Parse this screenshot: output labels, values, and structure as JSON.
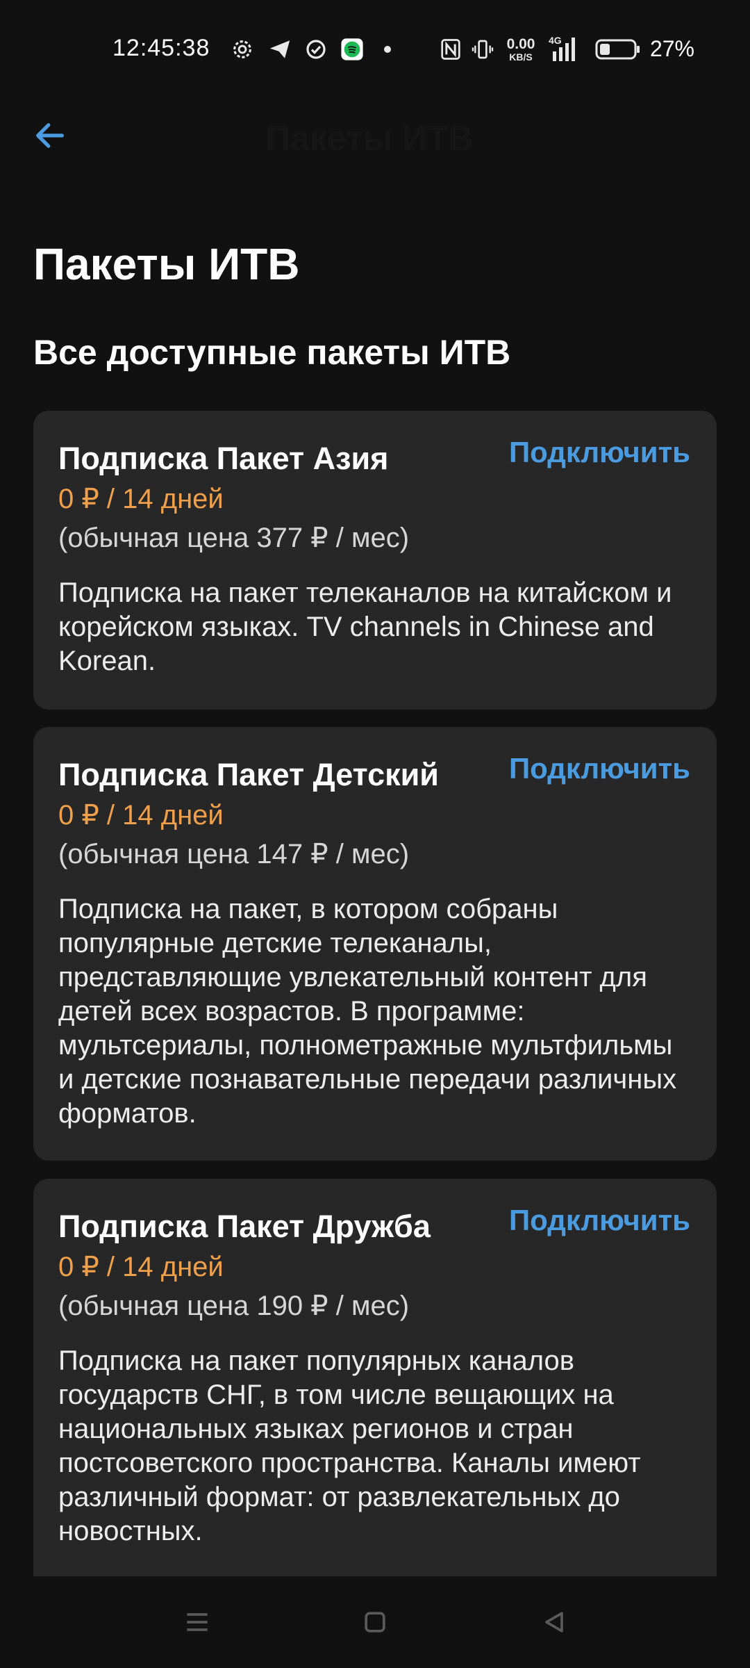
{
  "status_bar": {
    "time": "12:45:38",
    "net_speed_value": "0.00",
    "net_speed_unit": "KB/S",
    "network_type": "4G",
    "battery_percent": "27%",
    "icons": [
      "settings-gear-icon",
      "telegram-icon",
      "check-circle-icon",
      "spotify-icon",
      "dot-icon",
      "nfc-icon",
      "vibrate-icon",
      "signal-icon",
      "battery-icon"
    ]
  },
  "app_bar": {
    "title": "Пакеты ИТВ"
  },
  "page": {
    "title": "Пакеты ИТВ",
    "section_title": "Все доступные пакеты ИТВ"
  },
  "packages": [
    {
      "title": "Подписка Пакет Азия",
      "price": "0 ₽ / 14 дней",
      "regular_price": "(обычная цена 377 ₽ / мес)",
      "description": "Подписка на пакет телеканалов на китайском и корейском языках. TV channels in Chinese and Korean.",
      "action_label": "Подключить"
    },
    {
      "title": "Подписка Пакет Детский",
      "price": "0 ₽ / 14 дней",
      "regular_price": "(обычная цена 147 ₽ / мес)",
      "description": "Подписка на пакет, в котором собраны популярные детские телеканалы, представляющие увлекательный контент для детей всех возрастов. В программе: мультсериалы, полнометражные мультфильмы и детские познавательные передачи различных форматов.",
      "action_label": "Подключить"
    },
    {
      "title": "Подписка Пакет Дружба",
      "price": "0 ₽ / 14 дней",
      "regular_price": "(обычная цена 190 ₽ / мес)",
      "description": "Подписка на пакет популярных каналов государств СНГ, в том числе вещающих на национальных языках регионов и стран постсоветского пространства. Каналы имеют различный формат: от развлекательных до новостных.",
      "action_label": "Подключить"
    }
  ],
  "colors": {
    "background": "#111111",
    "card": "#272727",
    "accent": "#4a9be0",
    "price": "#f0a04b"
  }
}
